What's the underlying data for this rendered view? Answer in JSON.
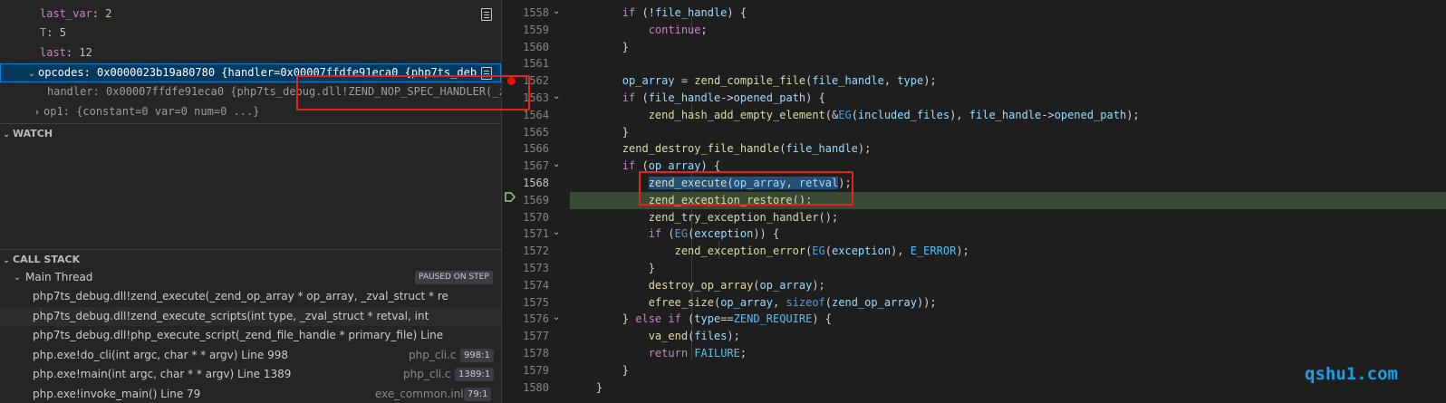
{
  "variables": {
    "rows": [
      {
        "name": "last_var",
        "sep": ": ",
        "value": "2"
      },
      {
        "name": "T",
        "sep": ": ",
        "value": "5"
      },
      {
        "name": "last",
        "sep": ": ",
        "value": "12"
      }
    ],
    "opcodes": {
      "name": "opcodes",
      "sep": ": ",
      "value": "0x0000023b19a80780 {handler=0x00007ffdfe91eca0 {php7ts_deb"
    },
    "handler": {
      "name": "handler",
      "sep": ": ",
      "value": "0x00007ffdfe91eca0 {php7ts_debug.dll!ZEND_NOP_SPEC_HANDLER(_z"
    },
    "op1": {
      "name": "op1",
      "sep": ": ",
      "value": "{constant=0 var=0 num=0 ...}"
    }
  },
  "watch": {
    "title": "WATCH"
  },
  "callstack": {
    "title": "CALL STACK",
    "thread": "Main Thread",
    "status": "PAUSED ON STEP",
    "frames": [
      {
        "name": "php7ts_debug.dll!zend_execute(_zend_op_array * op_array, _zval_struct * re",
        "file": "",
        "pos": ""
      },
      {
        "name": "php7ts_debug.dll!zend_execute_scripts(int type, _zval_struct * retval, int",
        "file": "",
        "pos": ""
      },
      {
        "name": "php7ts_debug.dll!php_execute_script(_zend_file_handle * primary_file) Line",
        "file": "",
        "pos": ""
      },
      {
        "name": "php.exe!do_cli(int argc, char * * argv) Line 998",
        "file": "php_cli.c",
        "pos": "998:1"
      },
      {
        "name": "php.exe!main(int argc, char * * argv) Line 1389",
        "file": "php_cli.c",
        "pos": "1389:1"
      },
      {
        "name": "php.exe!invoke_main() Line 79",
        "file": "exe_common.inl",
        "pos": "79:1"
      }
    ]
  },
  "editor": {
    "lines": [
      {
        "n": "1558",
        "fold": "⌄",
        "segs": [
          [
            "",
            "        "
          ],
          [
            "k",
            "if"
          ],
          [
            "",
            " (!"
          ],
          [
            "v",
            "file_handle"
          ],
          [
            "",
            ") {"
          ]
        ]
      },
      {
        "n": "1559",
        "fold": "",
        "segs": [
          [
            "",
            "            "
          ],
          [
            "k",
            "continue"
          ],
          [
            "",
            ";"
          ]
        ]
      },
      {
        "n": "1560",
        "fold": "",
        "segs": [
          [
            "",
            "        }"
          ]
        ]
      },
      {
        "n": "1561",
        "fold": "",
        "segs": [
          [
            "",
            ""
          ]
        ]
      },
      {
        "n": "1562",
        "fold": "",
        "segs": [
          [
            "",
            "        "
          ],
          [
            "v",
            "op_array"
          ],
          [
            "",
            " = "
          ],
          [
            "f",
            "zend_compile_file"
          ],
          [
            "",
            "("
          ],
          [
            "v",
            "file_handle"
          ],
          [
            "",
            ", "
          ],
          [
            "v",
            "type"
          ],
          [
            "",
            ");"
          ]
        ]
      },
      {
        "n": "1563",
        "fold": "⌄",
        "segs": [
          [
            "",
            "        "
          ],
          [
            "k",
            "if"
          ],
          [
            "",
            " ("
          ],
          [
            "v",
            "file_handle"
          ],
          [
            "",
            "->"
          ],
          [
            "v",
            "opened_path"
          ],
          [
            "",
            ") {"
          ]
        ]
      },
      {
        "n": "1564",
        "fold": "",
        "segs": [
          [
            "",
            "            "
          ],
          [
            "f",
            "zend_hash_add_empty_element"
          ],
          [
            "",
            "(&"
          ],
          [
            "t",
            "EG"
          ],
          [
            "",
            "("
          ],
          [
            "v",
            "included_files"
          ],
          [
            "",
            "), "
          ],
          [
            "v",
            "file_handle"
          ],
          [
            "",
            "->"
          ],
          [
            "v",
            "opened_path"
          ],
          [
            "",
            ");"
          ]
        ]
      },
      {
        "n": "1565",
        "fold": "",
        "segs": [
          [
            "",
            "        }"
          ]
        ]
      },
      {
        "n": "1566",
        "fold": "",
        "segs": [
          [
            "",
            "        "
          ],
          [
            "f",
            "zend_destroy_file_handle"
          ],
          [
            "",
            "("
          ],
          [
            "v",
            "file_handle"
          ],
          [
            "",
            ");"
          ]
        ]
      },
      {
        "n": "1567",
        "fold": "⌄",
        "segs": [
          [
            "",
            "        "
          ],
          [
            "k",
            "if"
          ],
          [
            "",
            " ("
          ],
          [
            "v",
            "op_array"
          ],
          [
            "",
            ") {"
          ]
        ]
      },
      {
        "n": "1568",
        "fold": "",
        "segs": [
          [
            "",
            "            "
          ],
          [
            "f",
            "zend_execute"
          ],
          [
            "",
            "("
          ],
          [
            "v",
            "op_array"
          ],
          [
            "",
            ", "
          ],
          [
            "v",
            "retval"
          ],
          [
            "",
            ");"
          ]
        ]
      },
      {
        "n": "1569",
        "fold": "",
        "segs": [
          [
            "",
            "            "
          ],
          [
            "f",
            "zend_exception_restore"
          ],
          [
            "",
            "();"
          ]
        ]
      },
      {
        "n": "1570",
        "fold": "",
        "segs": [
          [
            "",
            "            "
          ],
          [
            "f",
            "zend_try_exception_handler"
          ],
          [
            "",
            "();"
          ]
        ]
      },
      {
        "n": "1571",
        "fold": "⌄",
        "segs": [
          [
            "",
            "            "
          ],
          [
            "k",
            "if"
          ],
          [
            "",
            " ("
          ],
          [
            "t",
            "EG"
          ],
          [
            "",
            "("
          ],
          [
            "v",
            "exception"
          ],
          [
            "",
            ")) {"
          ]
        ]
      },
      {
        "n": "1572",
        "fold": "",
        "segs": [
          [
            "",
            "                "
          ],
          [
            "f",
            "zend_exception_error"
          ],
          [
            "",
            "("
          ],
          [
            "t",
            "EG"
          ],
          [
            "",
            "("
          ],
          [
            "v",
            "exception"
          ],
          [
            "",
            "), "
          ],
          [
            "c",
            "E_ERROR"
          ],
          [
            "",
            ");"
          ]
        ]
      },
      {
        "n": "1573",
        "fold": "",
        "segs": [
          [
            "",
            "            }"
          ]
        ]
      },
      {
        "n": "1574",
        "fold": "",
        "segs": [
          [
            "",
            "            "
          ],
          [
            "f",
            "destroy_op_array"
          ],
          [
            "",
            "("
          ],
          [
            "v",
            "op_array"
          ],
          [
            "",
            ");"
          ]
        ]
      },
      {
        "n": "1575",
        "fold": "",
        "segs": [
          [
            "",
            "            "
          ],
          [
            "f",
            "efree_size"
          ],
          [
            "",
            "("
          ],
          [
            "v",
            "op_array"
          ],
          [
            "",
            ", "
          ],
          [
            "t",
            "sizeof"
          ],
          [
            "",
            "("
          ],
          [
            "v",
            "zend_op_array"
          ],
          [
            "",
            "));"
          ]
        ]
      },
      {
        "n": "1576",
        "fold": "⌄",
        "segs": [
          [
            "",
            "        } "
          ],
          [
            "k",
            "else if"
          ],
          [
            "",
            " ("
          ],
          [
            "v",
            "type"
          ],
          [
            "",
            "=="
          ],
          [
            "c",
            "ZEND_REQUIRE"
          ],
          [
            "",
            ") {"
          ]
        ]
      },
      {
        "n": "1577",
        "fold": "",
        "segs": [
          [
            "",
            "            "
          ],
          [
            "f",
            "va_end"
          ],
          [
            "",
            "("
          ],
          [
            "v",
            "files"
          ],
          [
            "",
            ");"
          ]
        ]
      },
      {
        "n": "1578",
        "fold": "",
        "segs": [
          [
            "",
            "            "
          ],
          [
            "k",
            "return"
          ],
          [
            "",
            " "
          ],
          [
            "c",
            "FAILURE"
          ],
          [
            "",
            ";"
          ]
        ]
      },
      {
        "n": "1579",
        "fold": "",
        "segs": [
          [
            "",
            "        }"
          ]
        ]
      },
      {
        "n": "1580",
        "fold": "",
        "segs": [
          [
            "",
            "    }"
          ]
        ]
      }
    ]
  },
  "watermark": "qshu1.com"
}
